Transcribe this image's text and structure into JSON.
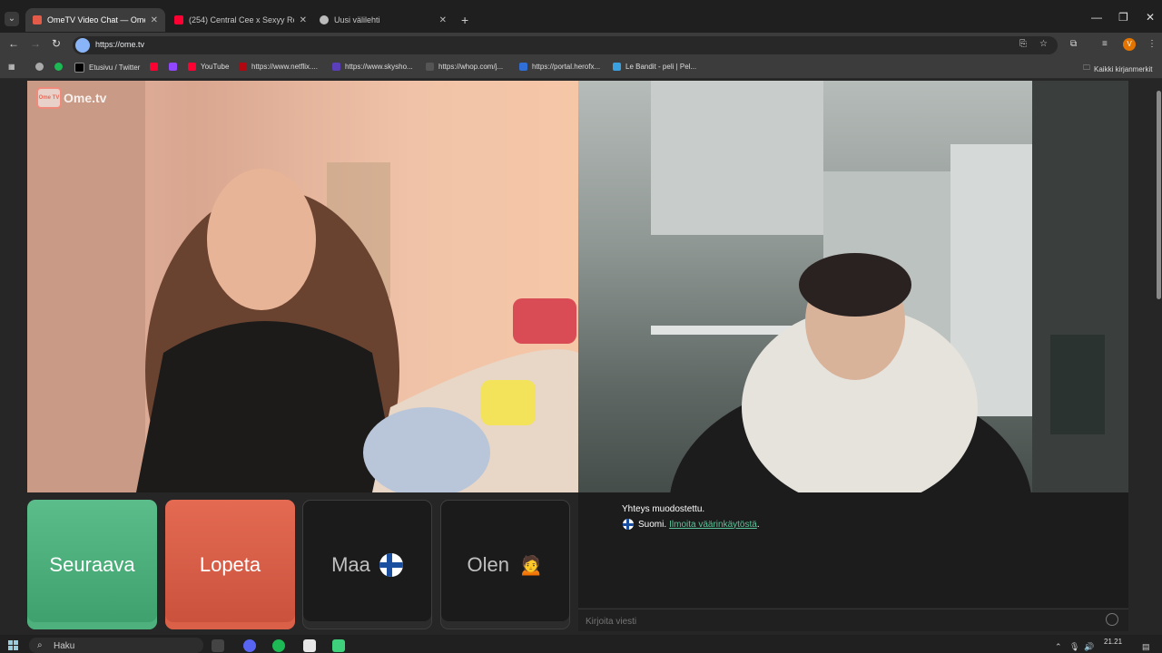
{
  "browser": {
    "tabs": [
      {
        "title": "OmeTV Video Chat — Ome",
        "active": true
      },
      {
        "title": "(254) Central Cee x Sexyy Red -",
        "active": false
      },
      {
        "title": "Uusi välilehti",
        "active": false
      }
    ],
    "new_tab_icon": "+",
    "url": "https://ome.tv",
    "bookmarks": [
      "Etusivu / Twitter",
      "YouTube",
      "https://www.netflix....",
      "https://www.skysho...",
      "https://whop.com/j...",
      "https://portal.herofx...",
      "Le Bandit - peli | Pel..."
    ],
    "all_bookmarks": "Kaikki kirjanmerkit",
    "profile_initial": "V"
  },
  "page": {
    "logo_text": "Ome.tv",
    "logo_badge": "Ome TV",
    "buttons": {
      "next": "Seuraava",
      "stop": "Lopeta",
      "country": "Maa",
      "gender": "Olen"
    },
    "chat": {
      "status": "Yhteys muodostettu.",
      "country": "Suomi.",
      "report_link": "Ilmoita väärinkäytöstä",
      "report_suffix": ".",
      "input_placeholder": "Kirjoita viesti"
    }
  },
  "taskbar": {
    "search_label": "Haku",
    "time": "21.21"
  },
  "colors": {
    "next_button": "#4aad79",
    "stop_button": "#d75c45",
    "report_link": "#5cc49a"
  }
}
